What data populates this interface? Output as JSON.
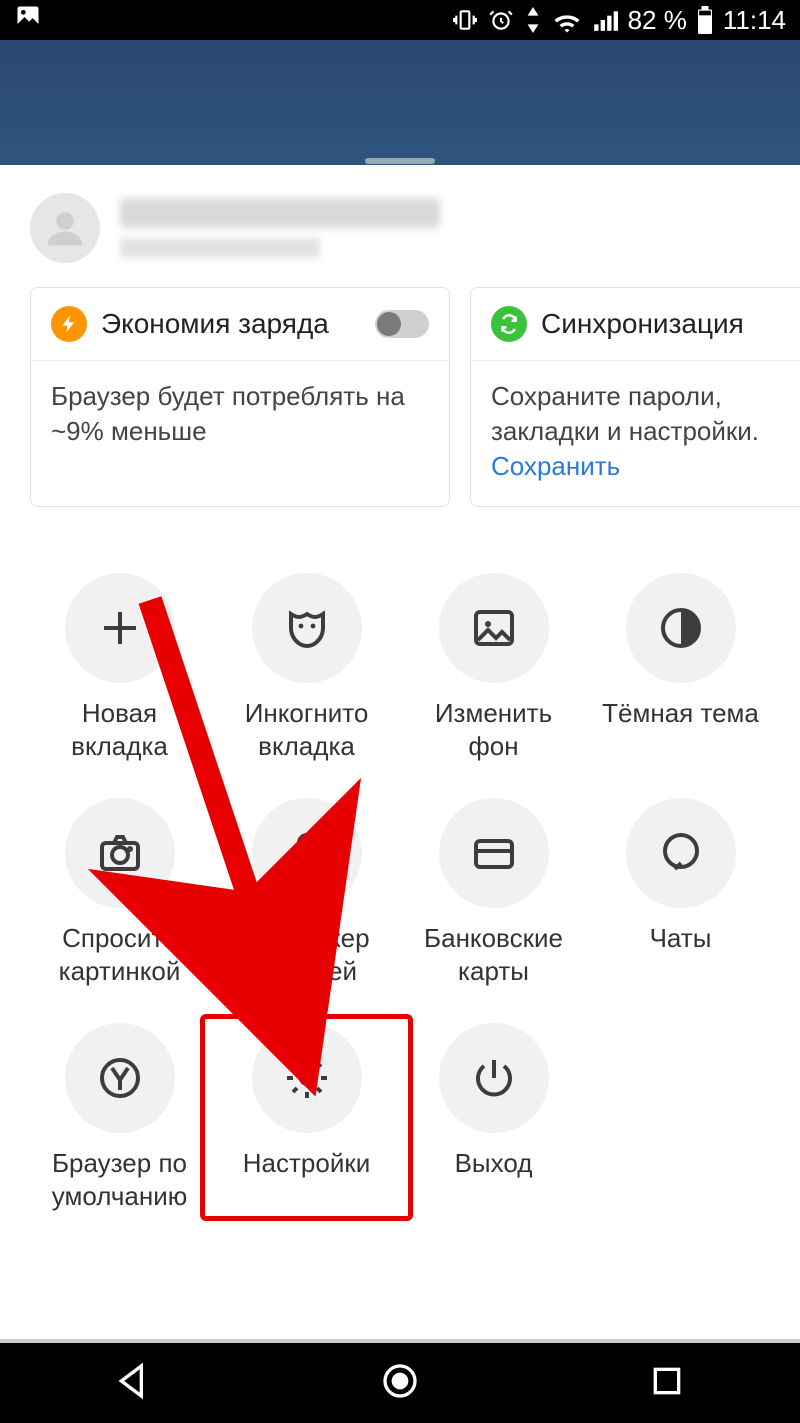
{
  "status": {
    "battery_pct": "82 %",
    "time": "11:14"
  },
  "cards": [
    {
      "icon_color": "orange",
      "title": "Экономия заряда",
      "body": "Браузер будет потреблять на ~9% меньше",
      "has_toggle": true
    },
    {
      "icon_color": "green",
      "title": "Синхронизация",
      "body_prefix": "Сохраните пароли, закладки и настройки. ",
      "body_link": "Сохранить"
    }
  ],
  "menu": [
    {
      "icon": "plus",
      "label": "Новая\nвкладка"
    },
    {
      "icon": "mask",
      "label": "Инкогнито\nвкладка"
    },
    {
      "icon": "image",
      "label": "Изменить\nфон"
    },
    {
      "icon": "half",
      "label": "Тёмная тема"
    },
    {
      "icon": "camera",
      "label": "Спросить\nкартинкой"
    },
    {
      "icon": "key",
      "label": "Менеджер\nпаролей"
    },
    {
      "icon": "card",
      "label": "Банковские\nкарты"
    },
    {
      "icon": "chat",
      "label": "Чаты"
    },
    {
      "icon": "yandex",
      "label": "Браузер по\nумолчанию"
    },
    {
      "icon": "gear",
      "label": "Настройки",
      "highlight": true
    },
    {
      "icon": "power",
      "label": "Выход"
    }
  ]
}
